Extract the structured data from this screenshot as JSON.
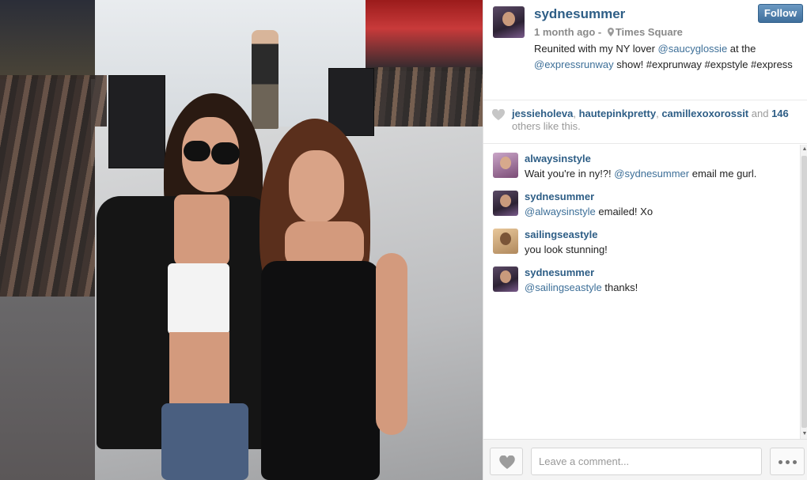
{
  "post": {
    "username": "sydnesummer",
    "follow_label": "Follow",
    "time": "1 month ago",
    "separator": " - ",
    "location": "Times Square",
    "caption": {
      "t1": "Reunited with my NY lover ",
      "m1": "@saucyglossie",
      "t2": " at the ",
      "m2": "@expressrunway",
      "t3": " show! #exprunway #expstyle #express"
    }
  },
  "likes": {
    "users": [
      "jessieholeva",
      "hautepinkpretty",
      "camillexoxorossit"
    ],
    "sep": ", ",
    "and": " and ",
    "count": "146",
    "suffix": " others like this."
  },
  "comments": [
    {
      "user": "alwaysinstyle",
      "pre": "Wait you're in ny!?! ",
      "mention": "@sydnesummer",
      "post": " email me gurl."
    },
    {
      "user": "sydnesummer",
      "pre": "",
      "mention": "@alwaysinstyle",
      "post": " emailed! Xo"
    },
    {
      "user": "sailingseastyle",
      "pre": "you look stunning!",
      "mention": "",
      "post": ""
    },
    {
      "user": "sydnesummer",
      "pre": "",
      "mention": "@sailingseastyle",
      "post": " thanks!"
    }
  ],
  "footer": {
    "comment_placeholder": "Leave a comment..."
  },
  "icons": {
    "location": "location-pin-icon",
    "heart": "heart-icon",
    "more": "more-dots-icon"
  },
  "colors": {
    "link": "#2e5e86",
    "follow_button": "#4a7aa6",
    "muted": "#8a8a8a"
  }
}
